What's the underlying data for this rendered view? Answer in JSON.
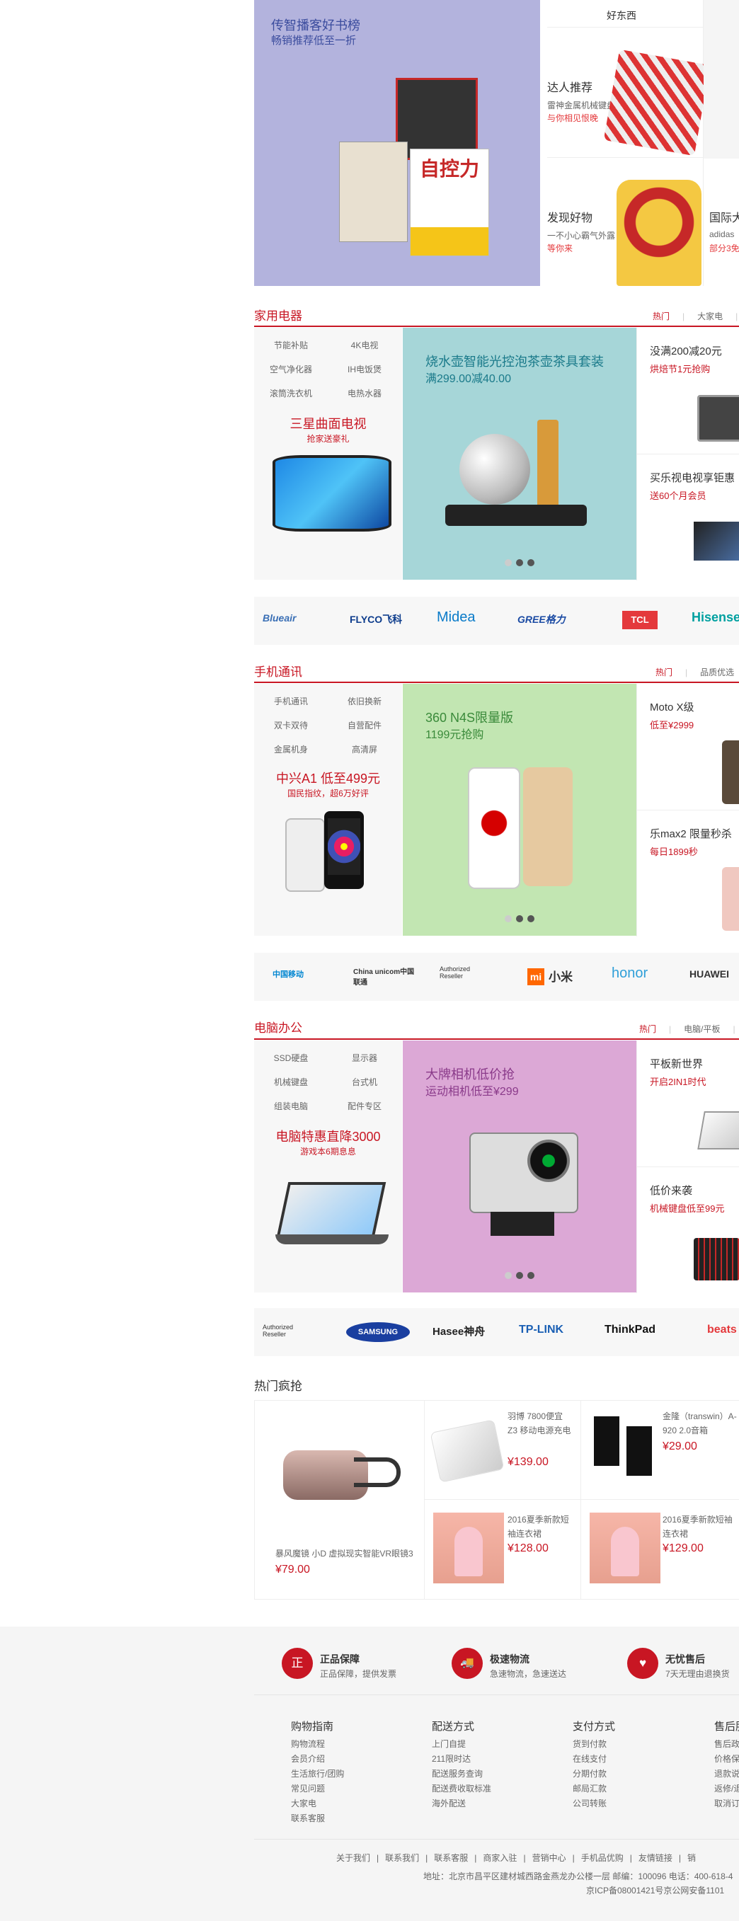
{
  "promo": {
    "title": "传智播客好书榜",
    "subtitle": "畅销推荐低至一折",
    "haodongxi": "好东西",
    "talent_title": "达人推荐",
    "talent_sub1": "雷神金属机械键盘",
    "talent_sub2": "与你相见恨晚",
    "discover_title": "发现好物",
    "discover_sub1": "一不小心霸气外露",
    "discover_sub2": "等你来",
    "intl_title": "国际大",
    "intl_sub1": "adidas",
    "intl_sub2": "部分3免"
  },
  "appliances": {
    "title": "家用电器",
    "tabs": [
      "热门",
      "大家电"
    ],
    "links": [
      "节能补贴",
      "4K电视",
      "空气净化器",
      "IH电饭煲",
      "滚筒洗衣机",
      "电热水器"
    ],
    "feature_title": "三星曲面电视",
    "feature_sub": "抢家送豪礼",
    "big_title": "烧水壶智能光控泡茶壶茶具套装",
    "big_sub": "满299.00减40.00",
    "side1_title": "没满200减20元",
    "side1_sub": "烘焙节1元抢购",
    "side2_title": "买乐视电视享钜惠",
    "side2_sub": "送60个月会员",
    "brands": [
      "Blueair",
      "FLYCO飞科",
      "Midea",
      "GREE格力",
      "TCL",
      "Hisense"
    ]
  },
  "phones": {
    "title": "手机通讯",
    "tabs": [
      "热门",
      "品质优选"
    ],
    "links": [
      "手机通讯",
      "依旧换新",
      "双卡双待",
      "自营配件",
      "金属机身",
      "高清屏"
    ],
    "feature_title": "中兴A1 低至499元",
    "feature_sub": "国民指纹，超6万好评",
    "big_title": "360 N4S限量版",
    "big_sub": "1199元抢购",
    "side1_title": "Moto X级",
    "side1_sub": "低至¥2999",
    "side2_title": "乐max2 限量秒杀",
    "side2_sub": "每日1899秒",
    "brands": [
      "中国移动",
      "China unicom中国联通",
      "Authorized Reseller",
      "小米",
      "honor",
      "HUAWEI"
    ]
  },
  "computers": {
    "title": "电脑办公",
    "tabs": [
      "热门",
      "电脑/平板"
    ],
    "links": [
      "SSD硬盘",
      "显示器",
      "机械键盘",
      "台式机",
      "组装电脑",
      "配件专区"
    ],
    "feature_title": "电脑特惠直降3000",
    "feature_sub": "游戏本6期息息",
    "big_title": "大牌相机低价抢",
    "big_sub": "运动相机低至¥299",
    "side1_title": "平板新世界",
    "side1_sub": "开启2IN1时代",
    "side2_title": "低价来袭",
    "side2_sub": "机械键盘低至99元",
    "brands": [
      "Authorized Reseller",
      "SAMSUNG",
      "Hasee神舟",
      "TP-LINK",
      "ThinkPad",
      "beats"
    ]
  },
  "hot": {
    "title": "热门疯抢",
    "items": [
      {
        "name": "暴风魔镜 小D 虚拟现实智能VR眼镜3",
        "price": "¥79.00"
      },
      {
        "name": "羽博 7800便宜 Z3 移动电源充电",
        "price": "¥139.00"
      },
      {
        "name": "金隆（transwin）A-920 2.0音箱",
        "price": "¥29.00"
      },
      {
        "name": "2016夏季新款短袖连衣裙",
        "price": "¥128.00"
      },
      {
        "name": "2016夏季新款短袖连衣裙",
        "price": "¥129.00"
      }
    ]
  },
  "footer": {
    "services": [
      {
        "icon": "正",
        "title": "正品保障",
        "sub": "正品保障，提供发票"
      },
      {
        "icon": "🚚",
        "title": "极速物流",
        "sub": "急速物流，急速送达"
      },
      {
        "icon": "♥",
        "title": "无忧售后",
        "sub": "7天无理由退换货"
      }
    ],
    "columns": [
      {
        "title": "购物指南",
        "links": [
          "购物流程",
          "会员介绍",
          "生活旅行/团购",
          "常见问题",
          "大家电",
          "联系客服"
        ]
      },
      {
        "title": "配送方式",
        "links": [
          "上门自提",
          "211限时达",
          "配送服务查询",
          "配送费收取标准",
          "海外配送"
        ]
      },
      {
        "title": "支付方式",
        "links": [
          "货到付款",
          "在线支付",
          "分期付款",
          "邮局汇款",
          "公司转账"
        ]
      },
      {
        "title": "售后服",
        "links": [
          "售后政",
          "价格保",
          "退款说",
          "返修/退",
          "取消订"
        ]
      }
    ],
    "links": [
      "关于我们",
      "联系我们",
      "联系客服",
      "商家入驻",
      "营销中心",
      "手机品优购",
      "友情链接",
      "销"
    ],
    "address": "地址：北京市昌平区建材城西路金燕龙办公楼一层 邮编：100096 电话：400-618-4",
    "icp": "京ICP备08001421号京公网安备1101"
  }
}
